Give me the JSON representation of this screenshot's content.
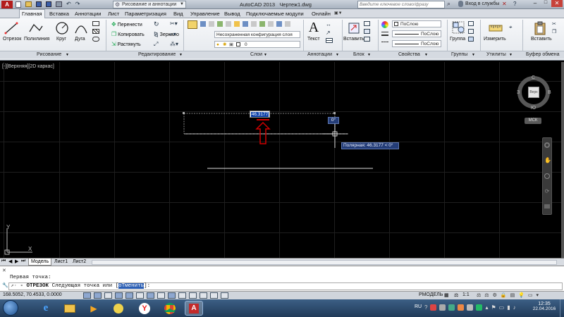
{
  "title": {
    "app": "AutoCAD 2013",
    "file": "Чертеж1.dwg",
    "workspace": "Рисование и аннотации",
    "search_placeholder": "Введите ключевое слово/фразу",
    "signin": "Вход в службы"
  },
  "menu": [
    "Главная",
    "Вставка",
    "Аннотации",
    "Лист",
    "Параметризация",
    "Вид",
    "Управление",
    "Вывод",
    "Подключаемые модули",
    "Онлайн"
  ],
  "ribbon": {
    "draw": {
      "line": "Отрезок",
      "polyline": "Полилиния",
      "circle": "Круг",
      "arc": "Дуга",
      "label": "Рисование"
    },
    "modify": {
      "move": "Перенести",
      "copy": "Копировать",
      "stretch": "Растянуть",
      "mirror": "Зеркало",
      "label": "Редактирование"
    },
    "layers": {
      "config": "Несохраненная конфигурация слоя",
      "layer": "0",
      "label": "Слои"
    },
    "annotation": {
      "text": "Текст",
      "label": "Аннотации"
    },
    "block": {
      "insert": "Вставить",
      "label": "Блок"
    },
    "properties": {
      "p1": "ПоСлою",
      "p2": "ПоСлою",
      "p3": "ПоСлою",
      "label": "Свойства"
    },
    "groups": {
      "group": "Группа",
      "label": "Группы"
    },
    "utilities": {
      "measure": "Измерить",
      "label": "Утилиты"
    },
    "clipboard": {
      "paste": "Вставить",
      "label": "Буфер обмена"
    }
  },
  "viewport": {
    "label": "[-][Верхняя][2D каркас]",
    "dim_value": "46.3177",
    "angle_value": "0°",
    "tooltip": "Полярная: 46.3177 < 0°",
    "compass": {
      "n": "С",
      "s": "Ю",
      "w": "З",
      "e": "В",
      "top": "Верх",
      "wcs": "МСК"
    },
    "ucs_y": "Y",
    "ucs_x": "X"
  },
  "layout_tabs": [
    "Модель",
    "Лист1",
    "Лист2"
  ],
  "command": {
    "history": "Первая точка:",
    "prompt_prefix": "- ОТРЕЗОК",
    "prompt_text": "Следующая точка или [",
    "option": "оТменить",
    "prompt_end": "]:"
  },
  "status": {
    "coords": "168.5052, 70.4533, 0.0000",
    "model": "РМОДЕЛЬ",
    "scale": "1:1"
  },
  "taskbar": {
    "lang": "RU",
    "time": "12:35",
    "date": "22.04.2016"
  },
  "colors": {
    "dim_box": "#0b3fa8",
    "tooltip_bg": "#243d78",
    "arrow": "#d00000",
    "taskbar": "#2a4a6e"
  }
}
